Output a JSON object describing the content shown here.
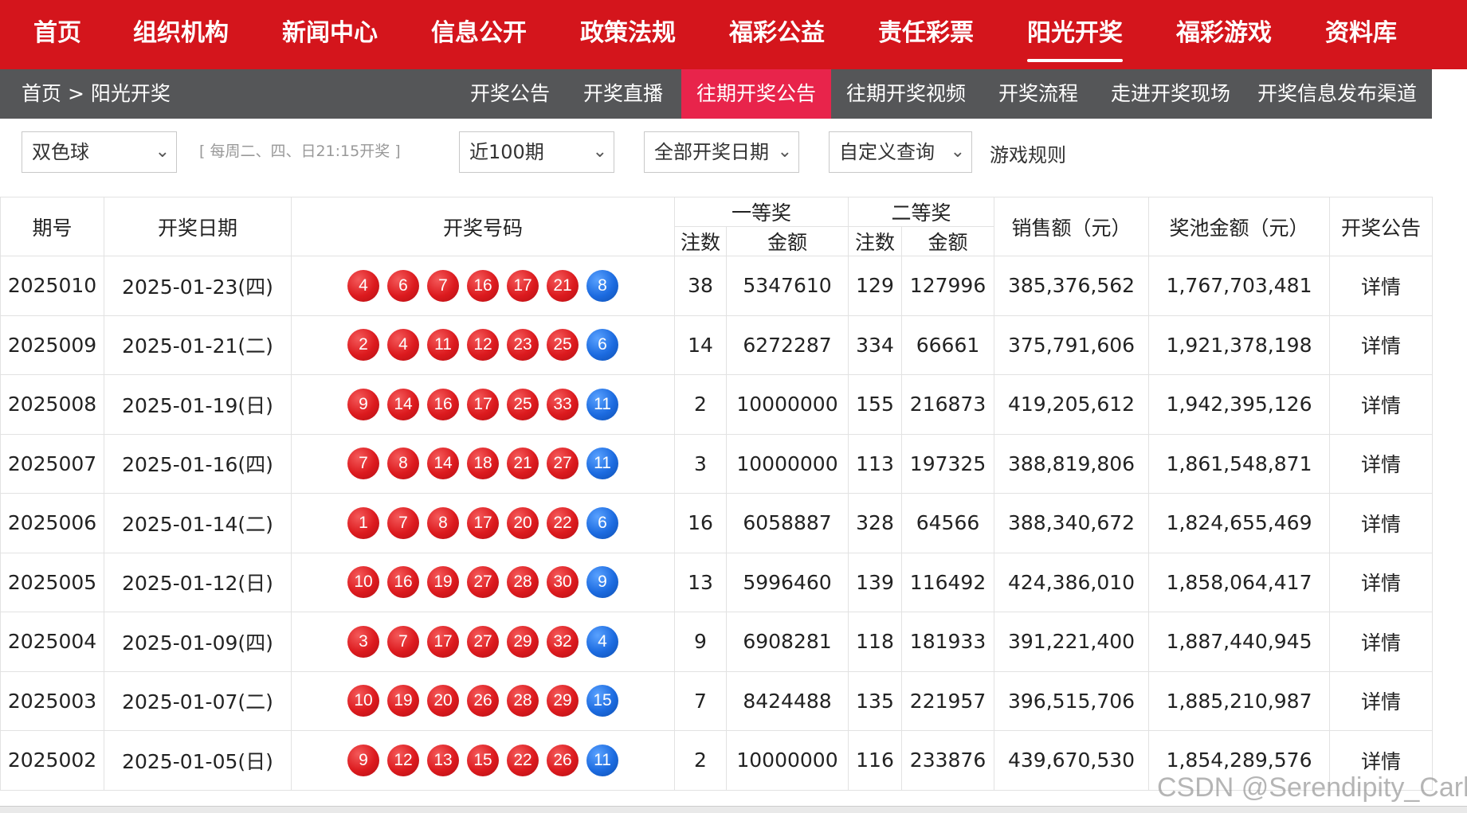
{
  "topnav": [
    {
      "label": "首页"
    },
    {
      "label": "组织机构"
    },
    {
      "label": "新闻中心"
    },
    {
      "label": "信息公开"
    },
    {
      "label": "政策法规"
    },
    {
      "label": "福彩公益"
    },
    {
      "label": "责任彩票"
    },
    {
      "label": "阳光开奖",
      "active": true
    },
    {
      "label": "福彩游戏"
    },
    {
      "label": "资料库"
    }
  ],
  "breadcrumb": {
    "home": "首页",
    "sep": ">",
    "current": "阳光开奖"
  },
  "subnav": [
    {
      "label": "开奖公告"
    },
    {
      "label": "开奖直播"
    },
    {
      "label": "往期开奖公告",
      "active": true
    },
    {
      "label": "往期开奖视频"
    },
    {
      "label": "开奖流程"
    },
    {
      "label": "走进开奖现场"
    },
    {
      "label": "开奖信息发布渠道"
    }
  ],
  "filters": {
    "game": "双色球",
    "schedule_hint": "[ 每周二、四、日21:15开奖 ]",
    "period": "近100期",
    "date": "全部开奖日期",
    "custom": "自定义查询",
    "rules": "游戏规则"
  },
  "table": {
    "headers": {
      "issue": "期号",
      "date": "开奖日期",
      "numbers": "开奖号码",
      "first_prize": "一等奖",
      "second_prize": "二等奖",
      "count": "注数",
      "amount": "金额",
      "sales": "销售额（元）",
      "pool": "奖池金额（元）",
      "notice": "开奖公告"
    },
    "detail_label": "详情",
    "rows": [
      {
        "issue": "2025010",
        "date": "2025-01-23(四)",
        "red": [
          "4",
          "6",
          "7",
          "16",
          "17",
          "21"
        ],
        "blue": "8",
        "p1n": "38",
        "p1a": "5347610",
        "p2n": "129",
        "p2a": "127996",
        "sales": "385,376,562",
        "pool": "1,767,703,481"
      },
      {
        "issue": "2025009",
        "date": "2025-01-21(二)",
        "red": [
          "2",
          "4",
          "11",
          "12",
          "23",
          "25"
        ],
        "blue": "6",
        "p1n": "14",
        "p1a": "6272287",
        "p2n": "334",
        "p2a": "66661",
        "sales": "375,791,606",
        "pool": "1,921,378,198"
      },
      {
        "issue": "2025008",
        "date": "2025-01-19(日)",
        "red": [
          "9",
          "14",
          "16",
          "17",
          "25",
          "33"
        ],
        "blue": "11",
        "p1n": "2",
        "p1a": "10000000",
        "p2n": "155",
        "p2a": "216873",
        "sales": "419,205,612",
        "pool": "1,942,395,126"
      },
      {
        "issue": "2025007",
        "date": "2025-01-16(四)",
        "red": [
          "7",
          "8",
          "14",
          "18",
          "21",
          "27"
        ],
        "blue": "11",
        "p1n": "3",
        "p1a": "10000000",
        "p2n": "113",
        "p2a": "197325",
        "sales": "388,819,806",
        "pool": "1,861,548,871"
      },
      {
        "issue": "2025006",
        "date": "2025-01-14(二)",
        "red": [
          "1",
          "7",
          "8",
          "17",
          "20",
          "22"
        ],
        "blue": "6",
        "p1n": "16",
        "p1a": "6058887",
        "p2n": "328",
        "p2a": "64566",
        "sales": "388,340,672",
        "pool": "1,824,655,469"
      },
      {
        "issue": "2025005",
        "date": "2025-01-12(日)",
        "red": [
          "10",
          "16",
          "19",
          "27",
          "28",
          "30"
        ],
        "blue": "9",
        "p1n": "13",
        "p1a": "5996460",
        "p2n": "139",
        "p2a": "116492",
        "sales": "424,386,010",
        "pool": "1,858,064,417"
      },
      {
        "issue": "2025004",
        "date": "2025-01-09(四)",
        "red": [
          "3",
          "7",
          "17",
          "27",
          "29",
          "32"
        ],
        "blue": "4",
        "p1n": "9",
        "p1a": "6908281",
        "p2n": "118",
        "p2a": "181933",
        "sales": "391,221,400",
        "pool": "1,887,440,945"
      },
      {
        "issue": "2025003",
        "date": "2025-01-07(二)",
        "red": [
          "10",
          "19",
          "20",
          "26",
          "28",
          "29"
        ],
        "blue": "15",
        "p1n": "7",
        "p1a": "8424488",
        "p2n": "135",
        "p2a": "221957",
        "sales": "396,515,706",
        "pool": "1,885,210,987"
      },
      {
        "issue": "2025002",
        "date": "2025-01-05(日)",
        "red": [
          "9",
          "12",
          "13",
          "15",
          "22",
          "26"
        ],
        "blue": "11",
        "p1n": "2",
        "p1a": "10000000",
        "p2n": "116",
        "p2a": "233876",
        "sales": "439,670,530",
        "pool": "1,854,289,576"
      }
    ]
  },
  "watermark": "CSDN @Serendipity_Carl",
  "colors": {
    "brand_red": "#d4151c",
    "subnav_gray": "#555658",
    "active_tab": "#e8244b",
    "red_ball": "#dc1a1e",
    "blue_ball": "#1c6be0"
  }
}
